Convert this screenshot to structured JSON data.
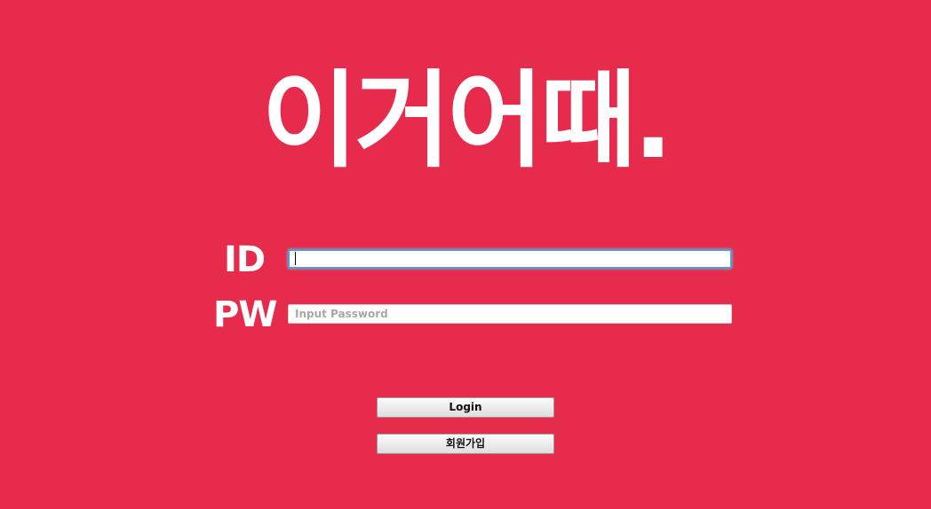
{
  "brand": {
    "logo_text": "이거어때.",
    "background_color": "#e62b4c",
    "logo_color": "#ffffff"
  },
  "login_form": {
    "id_label": "ID",
    "id_value": "",
    "pw_label": "PW",
    "pw_placeholder": "Input Password",
    "login_button": "Login",
    "signup_button": "회원가입"
  }
}
